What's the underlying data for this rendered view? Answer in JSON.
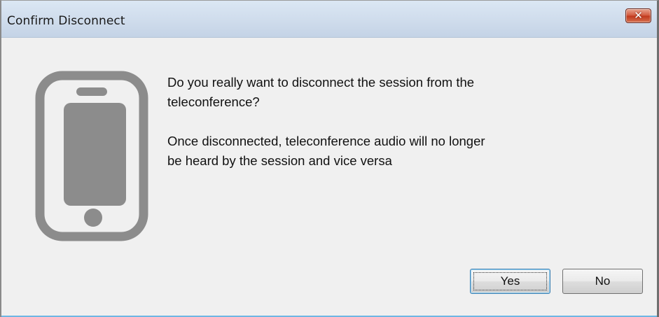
{
  "window": {
    "title": "Confirm Disconnect",
    "close_glyph": "✕"
  },
  "icon": {
    "name": "mobile-phone-icon",
    "color": "#8c8c8c"
  },
  "message": {
    "question": "Do you really want to disconnect the session from the\nteleconference?",
    "detail": "Once disconnected, teleconference audio will no longer\nbe heard by the session and vice versa"
  },
  "buttons": {
    "yes_label": "Yes",
    "no_label": "No"
  },
  "colors": {
    "close_button": "#c8462a",
    "focus_border": "#3c7fb1",
    "bottom_accent": "#6fb6e4"
  }
}
